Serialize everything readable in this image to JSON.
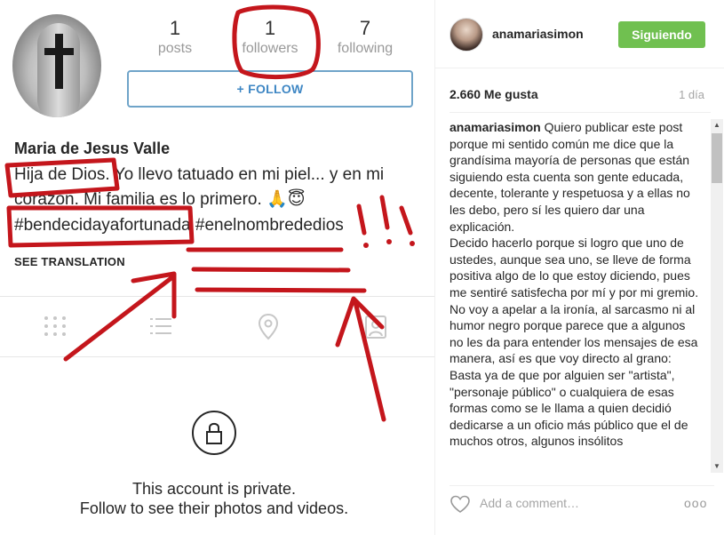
{
  "profile": {
    "stats": [
      {
        "num": "1",
        "label": "posts"
      },
      {
        "num": "1",
        "label": "followers"
      },
      {
        "num": "7",
        "label": "following"
      }
    ],
    "follow_button": "+ FOLLOW",
    "name": "Maria de Jesus Valle",
    "bio_line1": "Hija de Dios. Yo llevo tatuado en mi piel... y en mi",
    "bio_line2": "corazón. Mi familia es lo primero. 🙏😇",
    "bio_line3": "#bendecidayafortunada #enelnombrededios",
    "see_translation": "SEE TRANSLATION",
    "tabs": [
      "grid-icon",
      "list-icon",
      "location-icon",
      "tagged-icon"
    ],
    "private_line1": "This account is private.",
    "private_line2": "Follow to see their photos and videos."
  },
  "sidebar": {
    "username": "anamariasimon",
    "following_button": "Siguiendo",
    "likes": "2.660 Me gusta",
    "time": "1 día",
    "comment_user": "anamariasimon",
    "comment_paragraphs": [
      "Quiero publicar este post porque mi sentido común me dice que la grandísima mayoría de personas que están siguiendo esta cuenta son gente educada, decente, tolerante y respetuosa y a ellas no les debo, pero sí les quiero dar una explicación.",
      "Decido hacerlo porque si logro que uno de ustedes, aunque sea uno, se lleve de forma positiva algo de lo que estoy diciendo, pues me sentiré satisfecha por mí y por mi gremio.",
      "No voy a apelar a la ironía, al sarcasmo ni al humor negro porque parece que a algunos no les da para entender los mensajes de esa manera, así es que voy directo al grano:",
      "Basta ya de que por alguien ser \"artista\", \"personaje público\" o cualquiera de esas formas como se le llama a quien decidió dedicarse a un oficio más público que el de muchos otros, algunos insólitos"
    ],
    "add_comment_placeholder": "Add a comment…",
    "more_label": "ooo"
  },
  "colors": {
    "follow_green": "#70c050",
    "follow_blue": "#3f87c4",
    "annotation_red": "#c4161c"
  }
}
